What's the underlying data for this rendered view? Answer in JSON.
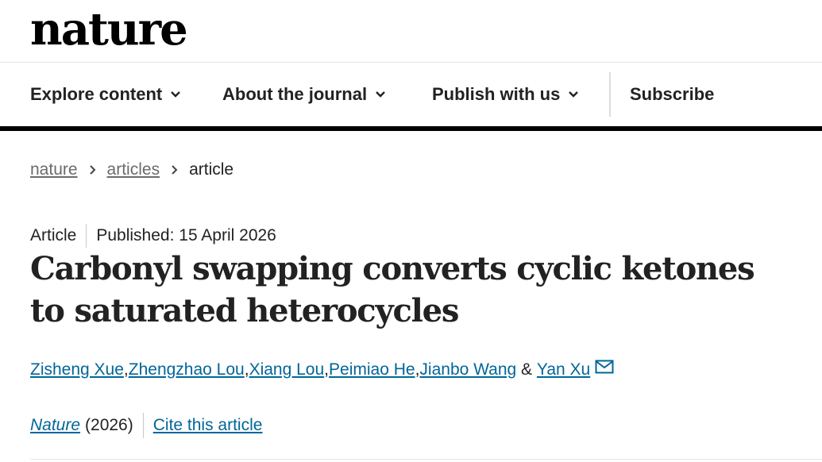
{
  "header": {
    "logo_text": "nature"
  },
  "nav": {
    "items": [
      {
        "label": "Explore content",
        "has_dropdown": true
      },
      {
        "label": "About the journal",
        "has_dropdown": true
      },
      {
        "label": "Publish with us",
        "has_dropdown": true
      },
      {
        "label": "Subscribe",
        "has_dropdown": false
      }
    ]
  },
  "breadcrumb": {
    "items": [
      {
        "label": "nature",
        "link": true
      },
      {
        "label": "articles",
        "link": true
      },
      {
        "label": "article",
        "link": false
      }
    ]
  },
  "article": {
    "type": "Article",
    "published": "Published: 15 April 2026",
    "title": "Carbonyl swapping converts cyclic ketones to saturated heterocycles",
    "authors": [
      "Zisheng Xue",
      "Zhengzhao Lou",
      "Xiang Lou",
      "Peimiao He",
      "Jianbo Wang",
      "Yan Xu"
    ],
    "author_separator": ", ",
    "author_final_separator": " & ",
    "journal": "Nature",
    "year": "(2026)",
    "cite_label": "Cite this article"
  },
  "colors": {
    "link": "#006699",
    "text": "#222222",
    "muted": "#6b6b6b",
    "accent_rule": "#000000"
  }
}
